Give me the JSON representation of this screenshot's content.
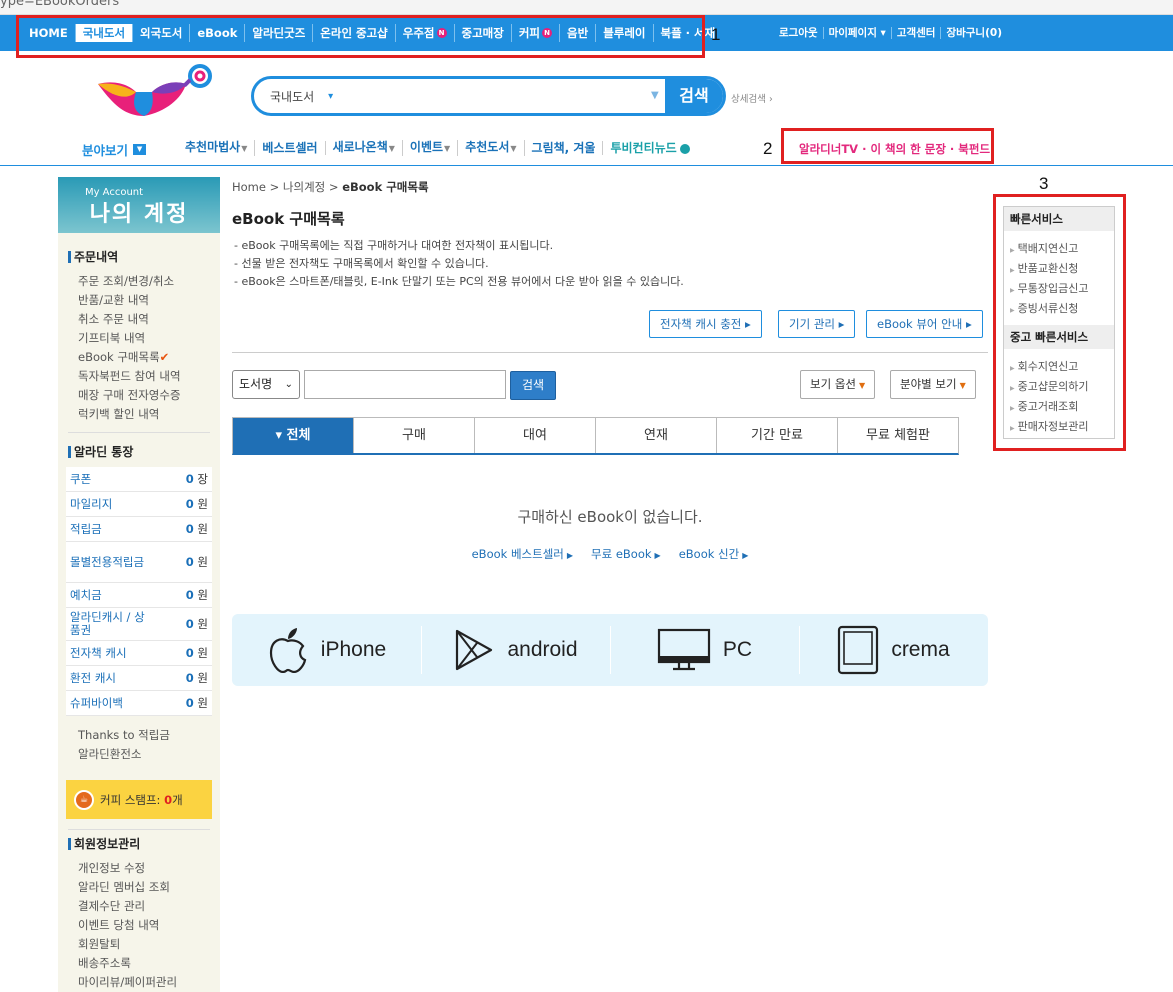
{
  "browser": {
    "url_fragment": "ype=EBookOrders"
  },
  "top_nav": {
    "items": [
      {
        "label": "HOME",
        "active": false,
        "badge": ""
      },
      {
        "label": "국내도서",
        "active": true,
        "badge": ""
      },
      {
        "label": "외국도서",
        "active": false,
        "badge": ""
      },
      {
        "label": "eBook",
        "active": false,
        "badge": ""
      },
      {
        "label": "알라딘굿즈",
        "active": false,
        "badge": ""
      },
      {
        "label": "온라인 중고샵",
        "active": false,
        "badge": ""
      },
      {
        "label": "우주점",
        "active": false,
        "badge": "N"
      },
      {
        "label": "중고매장",
        "active": false,
        "badge": ""
      },
      {
        "label": "커피",
        "active": false,
        "badge": "N"
      },
      {
        "label": "음반",
        "active": false,
        "badge": ""
      },
      {
        "label": "블루레이",
        "active": false,
        "badge": ""
      },
      {
        "label": "북플 · 서재",
        "active": false,
        "badge": ""
      }
    ],
    "right_links": [
      "로그아웃",
      "마이페이지 ▾",
      "고객센터",
      "장바구니(0)"
    ]
  },
  "annotations": [
    "1",
    "2",
    "3"
  ],
  "search": {
    "category": "국내도서",
    "placeholder": "",
    "button_label": "검색",
    "advanced_label": "상세검색 ›"
  },
  "category_nav": {
    "browse_label": "분야보기",
    "items": [
      {
        "label": "추천마법사",
        "dropdown": true
      },
      {
        "label": "베스트셀러",
        "dropdown": false
      },
      {
        "label": "새로나온책",
        "dropdown": true
      },
      {
        "label": "이벤트",
        "dropdown": true
      },
      {
        "label": "추천도서",
        "dropdown": true
      },
      {
        "label": "그림책, 겨울",
        "dropdown": false
      },
      {
        "label": "투비컨티뉴드",
        "dropdown": false
      }
    ],
    "promo": "알라디너TV · 이 책의 한 문장 · 북펀드"
  },
  "sidebar": {
    "header_en": "My Account",
    "header_ko": "나의 계정",
    "orders_title": "주문내역",
    "orders": [
      "주문 조회/변경/취소",
      "반품/교환 내역",
      "취소 주문 내역",
      "기프티북 내역",
      "eBook 구매목록",
      "독자북펀드 참여 내역",
      "매장 구매 전자영수증",
      "럭키백 할인 내역"
    ],
    "current_check": "✔",
    "account_title": "알라딘 통장",
    "points": [
      {
        "label": "쿠폰",
        "value": "0",
        "unit": "장"
      },
      {
        "label": "마일리지",
        "value": "0",
        "unit": "원"
      },
      {
        "label": "적립금",
        "value": "0",
        "unit": "원"
      },
      {
        "label": "몰별전용적립금",
        "value": "0",
        "unit": "원"
      },
      {
        "label": "예치금",
        "value": "0",
        "unit": "원"
      },
      {
        "label": "알라딘캐시 / 상품권",
        "value": "0",
        "unit": "원"
      },
      {
        "label": "전자책 캐시",
        "value": "0",
        "unit": "원"
      },
      {
        "label": "환전 캐시",
        "value": "0",
        "unit": "원"
      },
      {
        "label": "슈퍼바이백",
        "value": "0",
        "unit": "원"
      }
    ],
    "extra_links": [
      "Thanks to 적립금",
      "알라딘환전소"
    ],
    "stamp_label": "커피 스탬프: ",
    "stamp_count": "0",
    "stamp_unit": "개",
    "member_title": "회원정보관리",
    "member": [
      "개인정보 수정",
      "알라딘 멤버십 조회",
      "결제수단 관리",
      "이벤트 당첨 내역",
      "회원탈퇴",
      "배송주소록",
      "마이리뷰/페이퍼관리"
    ]
  },
  "breadcrumb": {
    "home": "Home",
    "sep": ">",
    "level1": "나의계정",
    "current": "eBook 구매목록"
  },
  "page_title": "eBook 구매목록",
  "notes": [
    "- eBook 구매목록에는 직접 구매하거나 대여한 전자책이 표시됩니다.",
    "- 선물 받은 전자책도 구매목록에서 확인할 수 있습니다.",
    "- eBook은 스마트폰/태블릿, E-Ink 단말기 또는 PC의 전용 뷰어에서 다운 받아 읽을 수 있습니다."
  ],
  "action_buttons": [
    "전자책 캐시 충전 ▸",
    "기기 관리 ▸",
    "eBook 뷰어 안내 ▸"
  ],
  "filter": {
    "select_value": "도서명",
    "search_button": "검색",
    "view_options": "보기 옵션",
    "category_view": "분야별 보기"
  },
  "tabs": [
    "▾ 전체",
    "구매",
    "대여",
    "연재",
    "기간 만료",
    "무료 체험판"
  ],
  "empty_message": "구매하신 eBook이 없습니다.",
  "empty_links": [
    "eBook 베스트셀러",
    "무료 eBook",
    "eBook 신간"
  ],
  "devices": [
    "iPhone",
    "android",
    "PC",
    "crema"
  ],
  "quick_service": {
    "title": "빠른서비스",
    "links": [
      "택배지연신고",
      "반품교환신청",
      "무통장입금신고",
      "증빙서류신청"
    ],
    "used_title": "중고 빠른서비스",
    "used_links": [
      "회수지연신고",
      "중고샵문의하기",
      "중고거래조회",
      "판매자정보관리"
    ]
  },
  "colors": {
    "brand": "#1f8ede",
    "highlight": "#e02020",
    "promo": "#e3297d"
  }
}
